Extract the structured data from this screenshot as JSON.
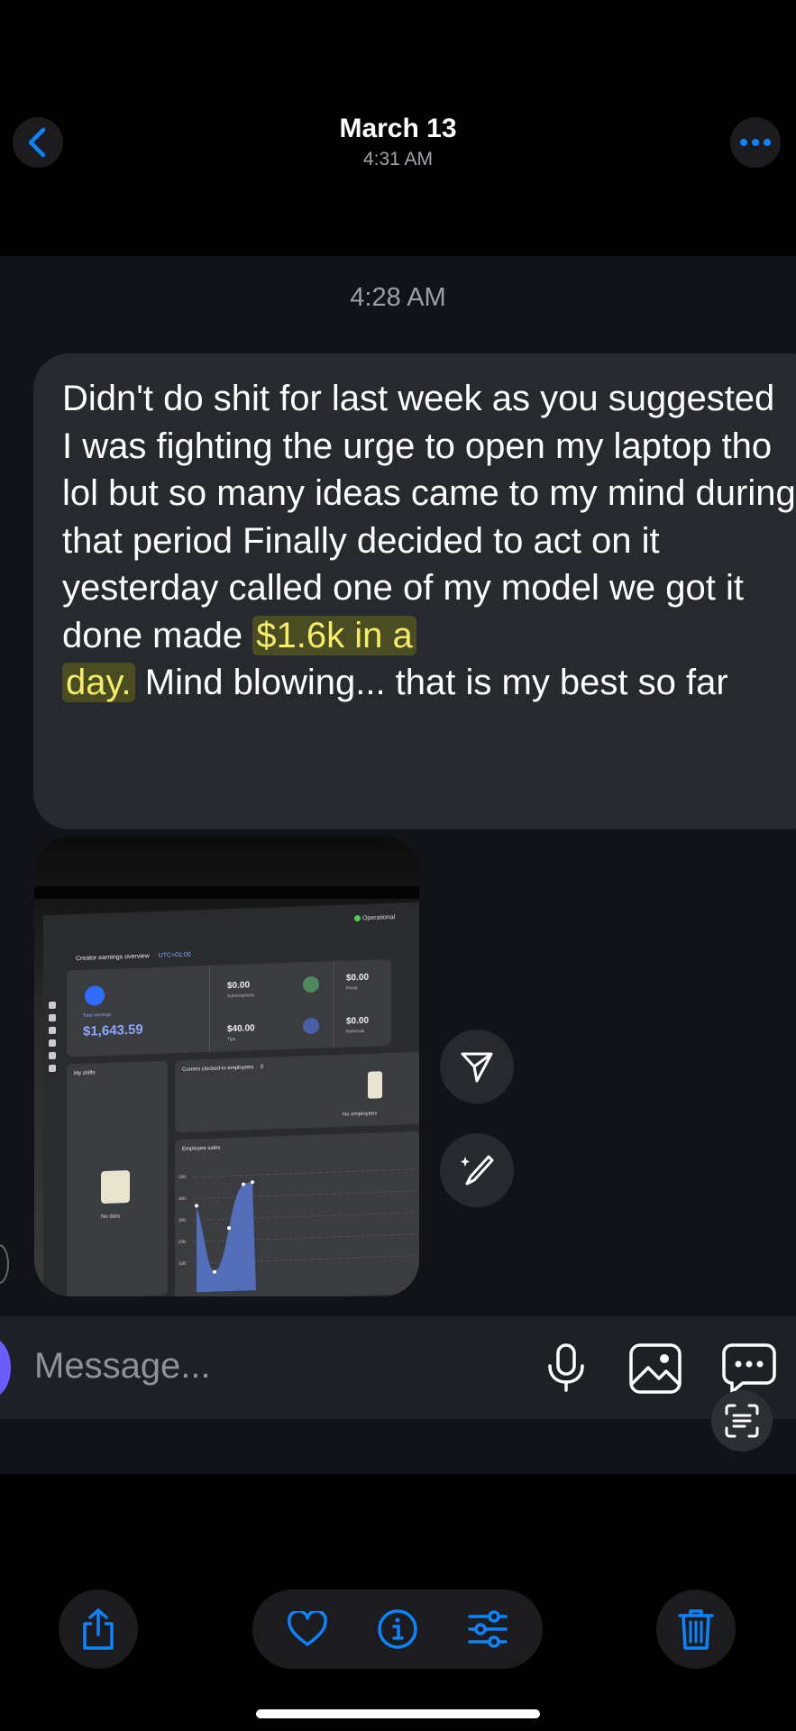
{
  "header": {
    "date": "March 13",
    "time": "4:31 AM"
  },
  "chat": {
    "timestamp": "4:28 AM",
    "message": {
      "part1": "Didn't do shit for last week as you suggested\nI was fighting the urge to open my laptop tho lol but so many ideas came to my mind during that period Finally decided to act on it yesterday called one of my model we got it done made",
      "highlight1": "$1.6k in a",
      "highlight2": "day.",
      "part2": " Mind blowing... that is my best so far"
    },
    "attachment": {
      "status": "Operational",
      "overview_title": "Creator earnings overview",
      "timezone": "UTC+01:00",
      "total_label": "Total earnings",
      "total_value": "$1,643.59",
      "subscriptions_value": "$0.00",
      "subscriptions_label": "Subscriptions",
      "posts_value": "$0.00",
      "posts_label": "Posts",
      "tips_value": "$40.00",
      "tips_label": "Tips",
      "referrals_value": "$0.00",
      "referrals_label": "Referrals",
      "shifts_label": "My shifts",
      "no_data": "No data",
      "clocked_label": "Current clocked-in employees",
      "clocked_count": "0",
      "no_employees": "No employees",
      "sales_label": "Employee sales",
      "ticks": [
        "500",
        "400",
        "300",
        "200",
        "100"
      ]
    }
  },
  "composer": {
    "placeholder": "Message..."
  },
  "icons": {
    "back": "chevron-left-icon",
    "more": "ellipsis-icon",
    "send": "send-icon",
    "edit": "sparkle-brush-icon",
    "mic": "microphone-icon",
    "gallery": "image-icon",
    "chat": "chat-bubble-icon",
    "scan": "live-text-icon",
    "share": "share-icon",
    "favorite": "heart-icon",
    "info": "info-icon",
    "adjust": "sliders-icon",
    "delete": "trash-icon"
  },
  "colors": {
    "accent": "#0a84ff",
    "highlight": "#f5ec6a"
  }
}
